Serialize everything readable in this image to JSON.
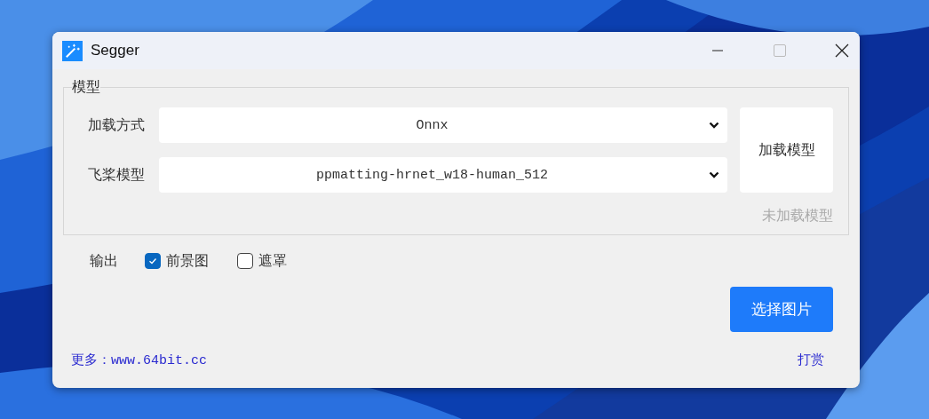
{
  "window": {
    "title": "Segger"
  },
  "model_group": {
    "legend": "模型",
    "fields": [
      {
        "label": "加载方式",
        "value": "Onnx"
      },
      {
        "label": "飞桨模型",
        "value": "ppmatting-hrnet_w18-human_512"
      }
    ],
    "load_button": "加载模型",
    "status": "未加载模型"
  },
  "output": {
    "label": "输出",
    "options": [
      {
        "label": "前景图",
        "checked": true
      },
      {
        "label": "遮罩",
        "checked": false
      }
    ]
  },
  "select_button": "选择图片",
  "footer": {
    "link": "更多：www.64bit.cc",
    "donate": "打赏"
  }
}
